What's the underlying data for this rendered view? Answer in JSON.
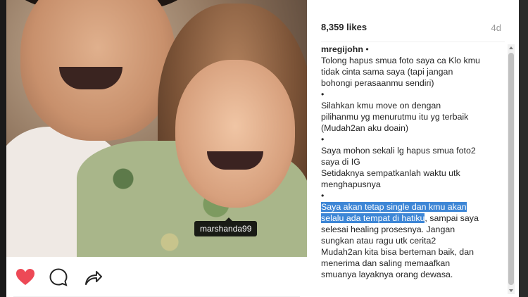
{
  "post": {
    "tagged_user": "marshanda99",
    "likes": "8,359 likes",
    "time_ago": "4d"
  },
  "actions": {
    "like_icon": "heart-icon",
    "comment_icon": "comment-icon",
    "share_icon": "share-icon",
    "like_color": "#ed4956"
  },
  "caption": {
    "username": "mregijohn",
    "username_suffix": " •",
    "lines": [
      "Tolong hapus smua foto saya ca Klo kmu",
      "tidak cinta sama saya (tapi jangan",
      "bohongi perasaanmu sendiri)",
      "•",
      "Silahkan kmu move on dengan",
      "pilihanmu yg menurutmu itu yg terbaik",
      "(Mudah2an aku doain)",
      "•",
      "Saya mohon sekali lg hapus smua foto2",
      "saya di IG",
      "Setidaknya sempatkanlah waktu utk",
      "menghapusnya",
      "•"
    ],
    "highlight_line1": "Saya akan tetap single dan kmu akan",
    "highlight_line2": "selalu ada tempat di hatiku",
    "after_highlight": ", sampai saya",
    "rest_lines": [
      "selesai healing prosesnya. Jangan",
      "sungkan atau ragu utk cerita2",
      "Mudah2an kita bisa berteman baik, dan",
      "menerima dan saling memaafkan",
      "smuanya layaknya orang dewasa."
    ]
  }
}
